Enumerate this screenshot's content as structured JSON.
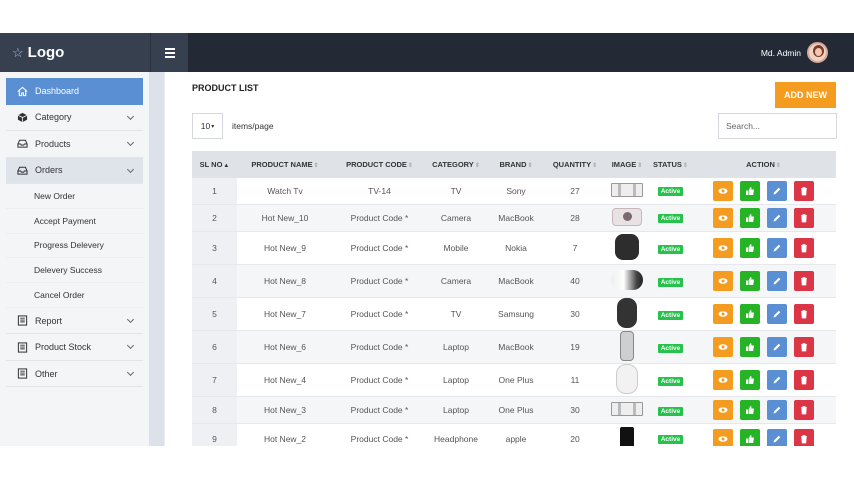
{
  "brand": {
    "logo_text": "Logo"
  },
  "header": {
    "user_name": "Md. Admin"
  },
  "sidebar": {
    "items": [
      {
        "label": "Dashboard",
        "icon": "home-icon",
        "active": true,
        "expandable": false
      },
      {
        "label": "Category",
        "icon": "cube-icon",
        "expandable": true
      },
      {
        "label": "Products",
        "icon": "inbox-icon",
        "expandable": true
      },
      {
        "label": "Orders",
        "icon": "inbox-icon",
        "expandable": true,
        "open": true,
        "children": [
          "New Order",
          "Accept Payment",
          "Progress Delevery",
          "Delevery Success",
          "Cancel Order"
        ]
      },
      {
        "label": "Report",
        "icon": "document-icon",
        "expandable": true
      },
      {
        "label": "Product Stock",
        "icon": "document-icon",
        "expandable": true
      },
      {
        "label": "Other",
        "icon": "document-icon",
        "expandable": true
      }
    ]
  },
  "main": {
    "title": "PRODUCT LIST",
    "add_button": "ADD NEW",
    "per_page_value": "10",
    "per_page_label": "items/page",
    "search_placeholder": "Search...",
    "columns": [
      "SL NO",
      "PRODUCT NAME",
      "PRODUCT CODE",
      "CATEGORY",
      "BRAND",
      "QUANTITY",
      "IMAGE",
      "STATUS",
      "ACTION"
    ],
    "rows": [
      {
        "sl": "1",
        "name": "Watch Tv",
        "code": "TV-14",
        "category": "TV",
        "brand": "Sony",
        "qty": "27",
        "image": "watch",
        "status": "Active"
      },
      {
        "sl": "2",
        "name": "Hot New_10",
        "code": "Product Code *",
        "category": "Camera",
        "brand": "MacBook",
        "qty": "28",
        "image": "camera",
        "status": "Active"
      },
      {
        "sl": "3",
        "name": "Hot New_9",
        "code": "Product Code *",
        "category": "Mobile",
        "brand": "Nokia",
        "qty": "7",
        "image": "speaker",
        "status": "Active"
      },
      {
        "sl": "4",
        "name": "Hot New_8",
        "code": "Product Code *",
        "category": "Camera",
        "brand": "MacBook",
        "qty": "40",
        "image": "lens",
        "status": "Active"
      },
      {
        "sl": "5",
        "name": "Hot New_7",
        "code": "Product Code *",
        "category": "TV",
        "brand": "Samsung",
        "qty": "30",
        "image": "mouse",
        "status": "Active"
      },
      {
        "sl": "6",
        "name": "Hot New_6",
        "code": "Product Code *",
        "category": "Laptop",
        "brand": "MacBook",
        "qty": "19",
        "image": "phone",
        "status": "Active"
      },
      {
        "sl": "7",
        "name": "Hot New_4",
        "code": "Product Code *",
        "category": "Laptop",
        "brand": "One Plus",
        "qty": "11",
        "image": "mouse-white",
        "status": "Active"
      },
      {
        "sl": "8",
        "name": "Hot New_3",
        "code": "Product Code *",
        "category": "Laptop",
        "brand": "One Plus",
        "qty": "30",
        "image": "watch",
        "status": "Active"
      },
      {
        "sl": "9",
        "name": "Hot New_2",
        "code": "Product Code *",
        "category": "Headphone",
        "brand": "apple",
        "qty": "20",
        "image": "tab",
        "status": "Active"
      }
    ]
  },
  "colors": {
    "accent": "#5b8fd3",
    "topbar": "#232a36",
    "add_button": "#f39c1f",
    "active_badge": "#27c24c"
  }
}
